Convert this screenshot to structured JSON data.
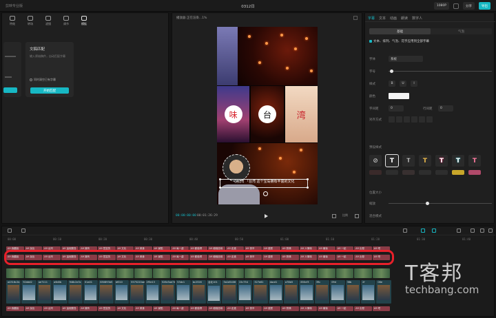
{
  "titlebar": {
    "app_name": "剪映专业版",
    "doc_title": "0312日",
    "buttons": [
      "1080P",
      "分享",
      "导出"
    ]
  },
  "left": {
    "tools": [
      "特效",
      "转场",
      "滤镜",
      "调节",
      "模板"
    ],
    "card": {
      "title": "文稿匹配",
      "desc": "输入原始稿件，自动匹配字幕",
      "checkbox": "同时清空已有字幕",
      "button": "开始匹配"
    }
  },
  "player": {
    "header": "播放器 正在渲染...1%",
    "timecode_current": "00:00:00:00",
    "timecode_total": "00:01:26:29",
    "ratio": "比例",
    "glyphs": [
      "味",
      "台",
      "湾"
    ],
    "subtitle": "[台]湾 「台湾 这个宝岛拥有丰富的文化"
  },
  "right": {
    "tabs": [
      "字幕",
      "文本",
      "动画",
      "朗读",
      "数字人"
    ],
    "segments": [
      "基础",
      "气泡"
    ],
    "apply_all": "文本、排列、气泡、花字应用到全部字幕",
    "labels": {
      "font": "字体",
      "font_value": "系统",
      "size": "字号",
      "style": "样式",
      "color": "颜色",
      "char_spacing": "字间距",
      "char_spacing_value": "0",
      "line_spacing": "行间距",
      "line_spacing_value": "0",
      "align": "对齐方式",
      "presets": "预设样式",
      "position": "位置大小",
      "scale": "缩放",
      "opacity": "混合模式"
    },
    "format_buttons": [
      "B",
      "U",
      "I"
    ],
    "preset_glyphs": [
      "⊘",
      "T",
      "T",
      "T",
      "T",
      "T",
      "T",
      "T"
    ]
  },
  "timeline": {
    "ticks": [
      "00:00",
      "00:10",
      "00:20",
      "00:30",
      "00:40",
      "00:50",
      "01:00",
      "01:10",
      "01:20",
      "01:30",
      "01:40"
    ],
    "highlight_clips": [
      "A9 我聽說",
      "A9 說出",
      "A9 台灣",
      "A9 這個寶島",
      "A9 擁有",
      "A9 豐富的",
      "A9 文化",
      "A9 美食",
      "A9 景點",
      "A9 每一處",
      "A9 都值得",
      "A9 細細品味",
      "A9 走進",
      "A9 夜市",
      "A9 感受",
      "A9 熱情",
      "A9 人情味",
      "A9 最後",
      "A9 一起",
      "A9 出發",
      "A9 吧"
    ],
    "video_labels": [
      "a4316c2b",
      "92ddd2",
      "ae7111",
      "a6d0b",
      "948c2e3c",
      "01a01",
      "850893b5",
      "bf010",
      "5575220ae8b7",
      "2f5e13",
      "526c5ae74a",
      "53dc1",
      "bc2326",
      "台北101",
      "5a1d5406",
      "15c754",
      "327e81",
      "dacd1",
      "a78b5",
      "850cf3",
      "39c",
      "09d",
      "36b",
      "2f",
      "06e"
    ]
  },
  "watermark": {
    "name": "T客邦",
    "url": "techbang.com"
  },
  "colors": {
    "accent": "#17b8c4",
    "highlight": "#e8202a",
    "caption_clip": "#8a3b46",
    "video_clip": "#23424a"
  }
}
